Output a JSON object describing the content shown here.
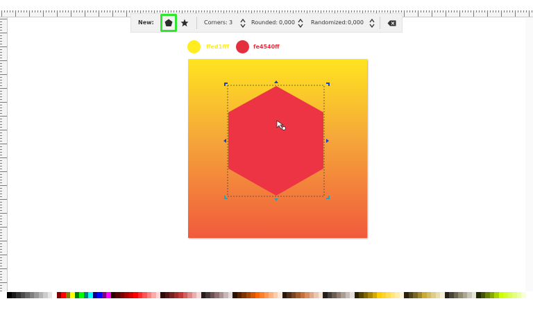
{
  "toolbar": {
    "new_label": "New:",
    "polygon_tool": "polygon-icon",
    "star_tool": "star-icon",
    "corners_label": "Corners:",
    "corners_value": "3",
    "rounded_label": "Rounded:",
    "rounded_value": "0,000",
    "randomized_label": "Randomized:",
    "randomized_value": "0,000",
    "clear_icon": "backspace-icon"
  },
  "swatches": [
    {
      "color": "#ffed1f",
      "label": "ffed1fff"
    },
    {
      "color": "#e4303e",
      "label": "fe4540ff"
    }
  ],
  "canvas": {
    "gradient_top": "#ffe41f",
    "gradient_bottom": "#f15a3c",
    "hexagon_fill": "#ec3444"
  },
  "palette_colors": [
    "#000000",
    "#1a1a1a",
    "#333333",
    "#4d4d4d",
    "#666666",
    "#808080",
    "#999999",
    "#b3b3b3",
    "#cccccc",
    "#e6e6e6",
    "#ffffff",
    "#800000",
    "#ff0000",
    "#808000",
    "#ffff00",
    "#008000",
    "#00ff00",
    "#008080",
    "#00ffff",
    "#000080",
    "#0000ff",
    "#800080",
    "#ff00ff",
    "#2b0000",
    "#550000",
    "#800000",
    "#aa0000",
    "#d40000",
    "#ff0000",
    "#ff2a2a",
    "#ff5555",
    "#ff8080",
    "#ffaaaa",
    "#ffd5d5",
    "#280b0b",
    "#501616",
    "#782121",
    "#a02c2c",
    "#c83737",
    "#d35f5f",
    "#de8787",
    "#e9afaf",
    "#f4d7d7",
    "#241c1c",
    "#483737",
    "#6c5353",
    "#916f6f",
    "#ac9393",
    "#c8b7b7",
    "#e3dbdb",
    "#2b1100",
    "#552200",
    "#803300",
    "#aa4400",
    "#d45500",
    "#ff6600",
    "#ff7f2a",
    "#ff9955",
    "#ffb380",
    "#ffccaa",
    "#ffe6d5",
    "#28170b",
    "#502d16",
    "#784421",
    "#a05a2c",
    "#c87137",
    "#d38d5f",
    "#deaa87",
    "#e9c6af",
    "#f4e3d7",
    "#241f1c",
    "#483e37",
    "#6c5d53",
    "#917c6f",
    "#ac9d93",
    "#c8beb7",
    "#e3dedb",
    "#2b2200",
    "#554400",
    "#806600",
    "#aa8800",
    "#d4aa00",
    "#ffcc00",
    "#ffd42a",
    "#ffdd55",
    "#ffe680",
    "#ffeeaa",
    "#fff6d5",
    "#28220b",
    "#504416",
    "#786721",
    "#a0892c",
    "#c8ab37",
    "#d3bc5f",
    "#decd87",
    "#e9ddaf",
    "#f4eed7",
    "#24221c",
    "#484537",
    "#6c6753",
    "#918a6f",
    "#aca793",
    "#c8c4b7",
    "#e3e2db",
    "#222b00",
    "#445500",
    "#668000",
    "#88aa00",
    "#aad400",
    "#ccff00",
    "#d4ff2a",
    "#ddff55",
    "#e5ff80",
    "#eeffaa",
    "#f6ffd5"
  ]
}
